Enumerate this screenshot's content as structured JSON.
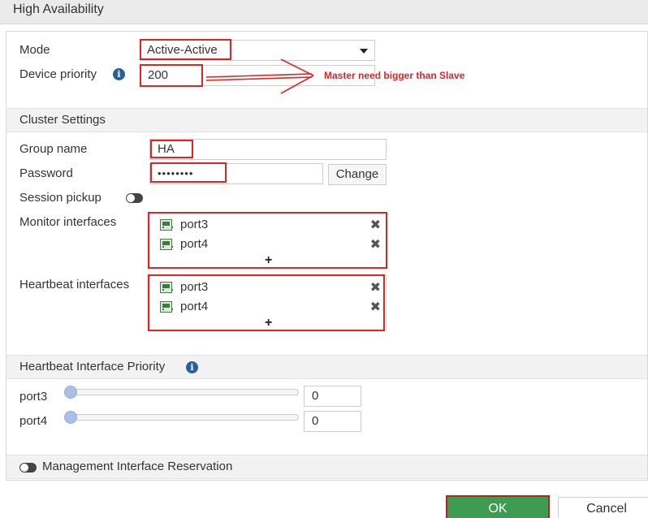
{
  "header": {
    "title": "High Availability"
  },
  "form": {
    "mode_label": "Mode",
    "mode_value": "Active-Active",
    "device_priority_label": "Device priority",
    "device_priority_value": "200",
    "annotation": "Master need bigger than Slave"
  },
  "cluster": {
    "section_title": "Cluster Settings",
    "group_name_label": "Group name",
    "group_name_value": "HA",
    "password_label": "Password",
    "password_value": "••••••••",
    "change_label": "Change",
    "session_pickup_label": "Session pickup",
    "monitor_label": "Monitor interfaces",
    "monitor_interfaces": [
      "port3",
      "port4"
    ],
    "heartbeat_label": "Heartbeat interfaces",
    "heartbeat_interfaces": [
      "port3",
      "port4"
    ],
    "add_symbol": "+",
    "remove_symbol": "✖"
  },
  "heartbeat_priority": {
    "section_title": "Heartbeat Interface Priority",
    "rows": [
      {
        "port": "port3",
        "value": "0"
      },
      {
        "port": "port4",
        "value": "0"
      }
    ]
  },
  "management": {
    "label": "Management Interface Reservation"
  },
  "footer": {
    "ok_label": "OK",
    "cancel_label": "Cancel"
  },
  "colors": {
    "annotation_red": "#e02424",
    "ok_green": "#3d9b52",
    "info_blue": "#2a5f9e"
  },
  "icons": {
    "info": "info-icon",
    "port": "port-icon",
    "remove": "remove-icon",
    "add": "add-icon",
    "toggle": "toggle-off"
  }
}
